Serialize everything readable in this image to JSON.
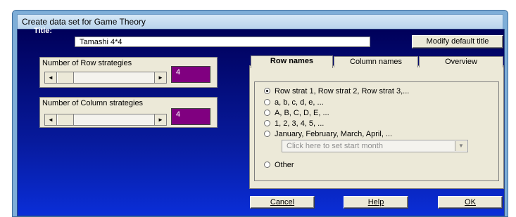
{
  "window": {
    "title": "Create data set for Game Theory"
  },
  "title_field": {
    "label": "Title:",
    "value": "Tamashi 4*4"
  },
  "buttons": {
    "modify_title": "Modify default title",
    "cancel": "Cancel",
    "help": "Help",
    "ok": "OK"
  },
  "row_strategies": {
    "label": "Number of Row strategies",
    "value": "4"
  },
  "column_strategies": {
    "label": "Number of Column strategies",
    "value": "4"
  },
  "tabs": [
    {
      "label": "Row names",
      "active": true
    },
    {
      "label": "Column names",
      "active": false
    },
    {
      "label": "Overview",
      "active": false
    }
  ],
  "options": [
    {
      "label": "Row strat 1, Row strat 2, Row strat 3,...",
      "selected": true
    },
    {
      "label": "a, b, c, d, e, ...",
      "selected": false
    },
    {
      "label": "A, B, C, D, E, ...",
      "selected": false
    },
    {
      "label": "1, 2, 3, 4, 5, ...",
      "selected": false
    },
    {
      "label": "January, February, March, April, ...",
      "selected": false
    },
    {
      "label": "Other",
      "selected": false
    }
  ],
  "month_combo": {
    "placeholder": "Click here to set start month"
  },
  "icons": {
    "scroll_left": "◄",
    "scroll_right": "►",
    "dropdown": "▼"
  }
}
